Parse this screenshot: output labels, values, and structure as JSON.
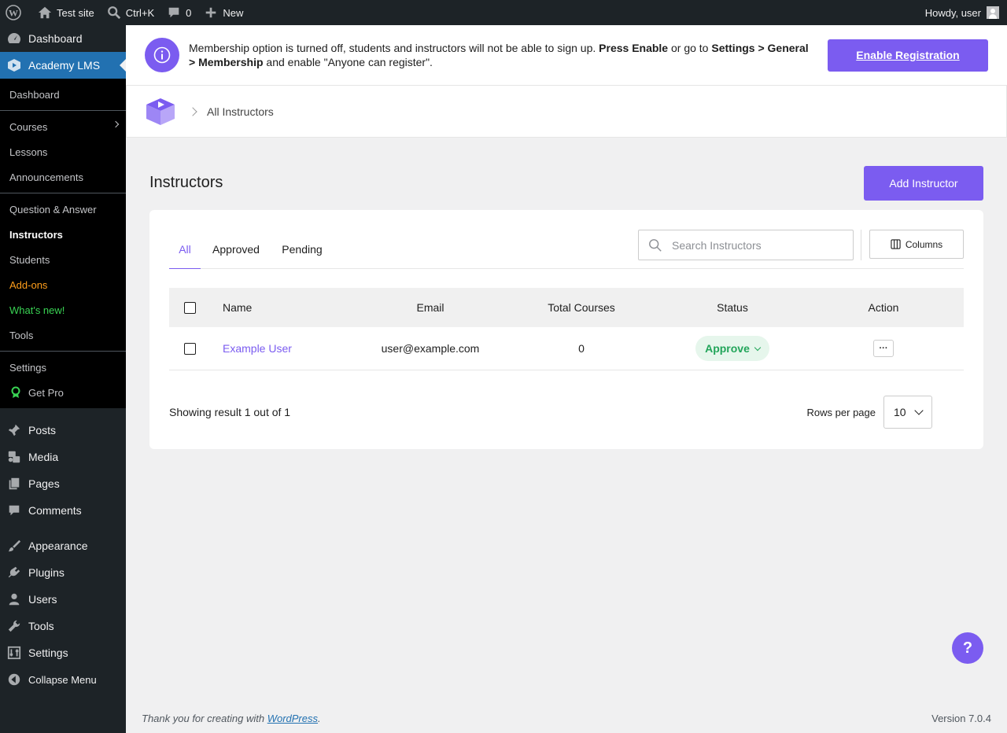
{
  "adminbar": {
    "site_name": "Test site",
    "search_shortcut": "Ctrl+K",
    "comments_count": "0",
    "new_label": "New",
    "greeting": "Howdy, user"
  },
  "sidebar": {
    "dashboard": "Dashboard",
    "academy": "Academy LMS",
    "submenu_groups": [
      [
        "Dashboard"
      ],
      [
        "Courses",
        "Lessons",
        "Announcements"
      ],
      [
        "Question & Answer",
        "Instructors",
        "Students",
        "Add-ons",
        "What's new!",
        "Tools"
      ],
      [
        "Settings",
        "Get Pro"
      ]
    ],
    "wp_menu": {
      "posts": "Posts",
      "media": "Media",
      "pages": "Pages",
      "comments": "Comments",
      "appearance": "Appearance",
      "plugins": "Plugins",
      "users": "Users",
      "tools": "Tools",
      "settings": "Settings",
      "collapse": "Collapse Menu"
    }
  },
  "notice": {
    "part1": "Membership option is turned off, students and instructors will not be able to sign up. ",
    "press_enable": "Press Enable",
    "part2": " or go to ",
    "settings_path": "Settings > General > Membership",
    "part3": " and enable \"Anyone can register\".",
    "button": "Enable Registration"
  },
  "breadcrumb": {
    "current": "All Instructors"
  },
  "page": {
    "title": "Instructors",
    "add_button": "Add Instructor"
  },
  "tabs": [
    "All",
    "Approved",
    "Pending"
  ],
  "search": {
    "placeholder": "Search Instructors"
  },
  "columns_button": "Columns",
  "table": {
    "headers": {
      "name": "Name",
      "email": "Email",
      "courses": "Total Courses",
      "status": "Status",
      "action": "Action"
    },
    "rows": [
      {
        "name": "Example User",
        "email": "user@example.com",
        "courses": "0",
        "status": "Approve",
        "action": "···"
      }
    ]
  },
  "pagination": {
    "showing": "Showing result 1 out of 1",
    "rows_per_page_label": "Rows per page",
    "rows_per_page": "10"
  },
  "help": "?",
  "footer": {
    "thanks_prefix": "Thank you for creating with ",
    "wordpress": "WordPress",
    "thanks_suffix": ".",
    "version": "Version 7.0.4"
  },
  "colors": {
    "accent": "#7b5cf0",
    "wp_blue": "#2271b1",
    "sidebar_bg": "#1d2327",
    "status_green": "#22a55a"
  }
}
